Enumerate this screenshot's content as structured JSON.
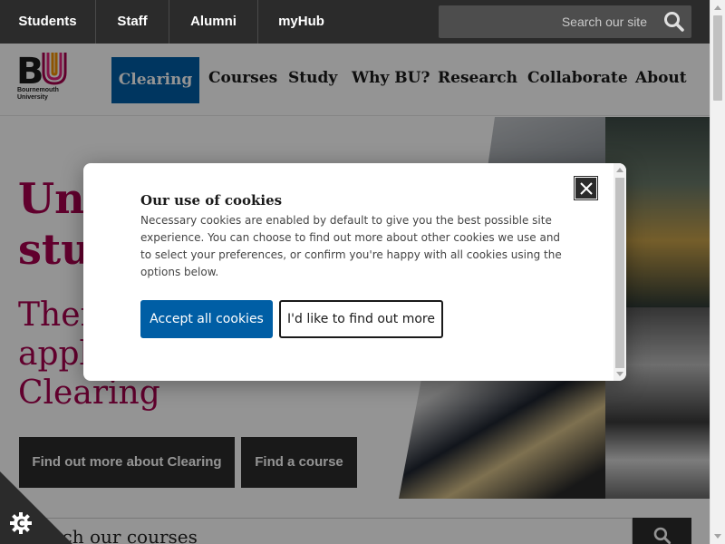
{
  "topbar": {
    "links": [
      "Students",
      "Staff",
      "Alumni",
      "myHub"
    ],
    "search_placeholder": "Search our site",
    "search_icon": "search-icon"
  },
  "header": {
    "logo_text_line1": "Bournemouth",
    "logo_text_line2": "University",
    "clearing": "Clearing",
    "nav": [
      "Courses",
      "Study",
      "Why BU?",
      "Research",
      "Collaborate",
      "About"
    ]
  },
  "hero": {
    "title_line1": "Une",
    "title_line2": "stu",
    "sub_line1": "Ther",
    "sub_line2": "appl",
    "sub_line3": "Clearing",
    "btn_clearing": "Find out more about Clearing",
    "btn_course": "Find a course"
  },
  "courses": {
    "placeholder": "rch our courses"
  },
  "cookie": {
    "title": "Our use of cookies",
    "body": "Necessary cookies are enabled by default to give you the best possible site experience. You can choose to find out more about other cookies we use and to select your preferences, or confirm you're happy with all cookies using the options below.",
    "accept": "Accept all cookies",
    "more": "I'd like to find out more",
    "close_icon": "close-icon",
    "badge_icon": "cookie-settings-icon"
  },
  "colors": {
    "brand_magenta": "#a7004f",
    "brand_blue": "#005ea5",
    "dark": "#2b2b2b"
  }
}
